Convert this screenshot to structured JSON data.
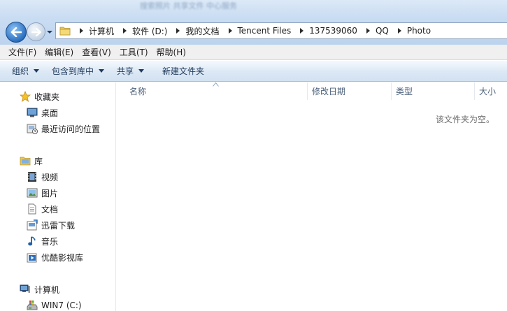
{
  "window": {
    "title_ghost": "搜索照片  共享文件  中心服务"
  },
  "address": {
    "crumbs": [
      "计算机",
      "软件 (D:)",
      "我的文档",
      "Tencent Files",
      "137539060",
      "QQ",
      "Photo"
    ]
  },
  "menubar": {
    "items": [
      "文件(F)",
      "编辑(E)",
      "查看(V)",
      "工具(T)",
      "帮助(H)"
    ]
  },
  "commandbar": {
    "organize": "组织",
    "include_in_library": "包含到库中",
    "share": "共享",
    "new_folder": "新建文件夹"
  },
  "navigation": {
    "favorites": {
      "label": "收藏夹",
      "items": [
        {
          "label": "桌面",
          "icon": "desktop-icon"
        },
        {
          "label": "最近访问的位置",
          "icon": "recent-places-icon"
        }
      ]
    },
    "libraries": {
      "label": "库",
      "items": [
        {
          "label": "视频",
          "icon": "video-library-icon"
        },
        {
          "label": "图片",
          "icon": "pictures-library-icon"
        },
        {
          "label": "文档",
          "icon": "documents-library-icon"
        },
        {
          "label": "迅雷下载",
          "icon": "thunder-download-icon"
        },
        {
          "label": "音乐",
          "icon": "music-library-icon"
        },
        {
          "label": "优酷影视库",
          "icon": "youku-library-icon"
        }
      ]
    },
    "computer": {
      "label": "计算机",
      "items": [
        {
          "label": "WIN7 (C:)",
          "icon": "drive-icon"
        }
      ]
    }
  },
  "content": {
    "columns": {
      "name": "名称",
      "date": "修改日期",
      "type": "类型",
      "size": "大小"
    },
    "empty_message": "该文件夹为空。"
  }
}
